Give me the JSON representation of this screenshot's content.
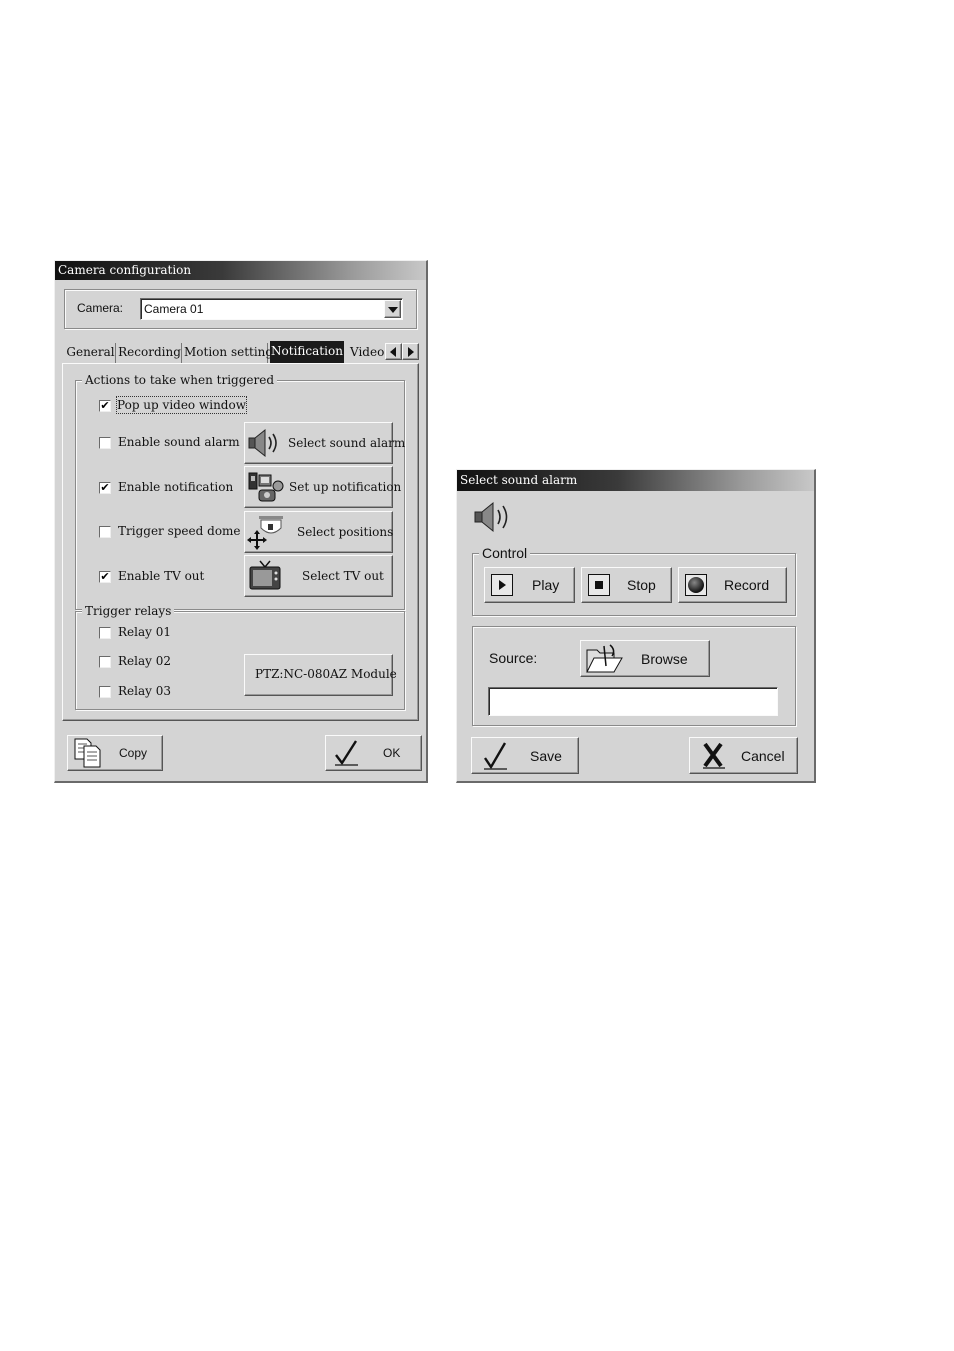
{
  "camera_config": {
    "title": "Camera configuration",
    "camera_label": "Camera:",
    "camera_value": "Camera 01",
    "tabs": [
      {
        "label": "General"
      },
      {
        "label": "Recording"
      },
      {
        "label": "Motion setting"
      },
      {
        "label": "Notification",
        "active": true
      },
      {
        "label": "Video"
      }
    ],
    "actions_legend": "Actions to take when triggered",
    "actions": [
      {
        "label": "Pop up video window",
        "checked": true
      },
      {
        "label": "Enable sound alarm",
        "checked": false
      },
      {
        "label": "Enable notification",
        "checked": true
      },
      {
        "label": "Trigger speed dome",
        "checked": false
      },
      {
        "label": "Enable TV out",
        "checked": true
      }
    ],
    "action_buttons": {
      "sound": "Select sound alarm",
      "notification": "Set up notification",
      "positions": "Select positions",
      "tv": "Select TV out"
    },
    "relays_legend": "Trigger relays",
    "relays": [
      {
        "label": "Relay 01",
        "checked": false
      },
      {
        "label": "Relay 02",
        "checked": false
      },
      {
        "label": "Relay 03",
        "checked": false
      }
    ],
    "ptz_button": "PTZ:NC-080AZ Module",
    "copy_button": "Copy",
    "ok_button": "OK"
  },
  "sound_alarm": {
    "title": "Select sound alarm",
    "control_legend": "Control",
    "play": "Play",
    "stop": "Stop",
    "record": "Record",
    "source_label": "Source:",
    "browse": "Browse",
    "source_value": "",
    "save": "Save",
    "cancel": "Cancel"
  },
  "icons": [
    "speaker-icon",
    "notification-icon",
    "speed-dome-icon",
    "tv-icon",
    "copy-icon",
    "check-icon",
    "play-icon",
    "stop-icon",
    "record-icon",
    "folder-icon",
    "cancel-x-icon"
  ]
}
